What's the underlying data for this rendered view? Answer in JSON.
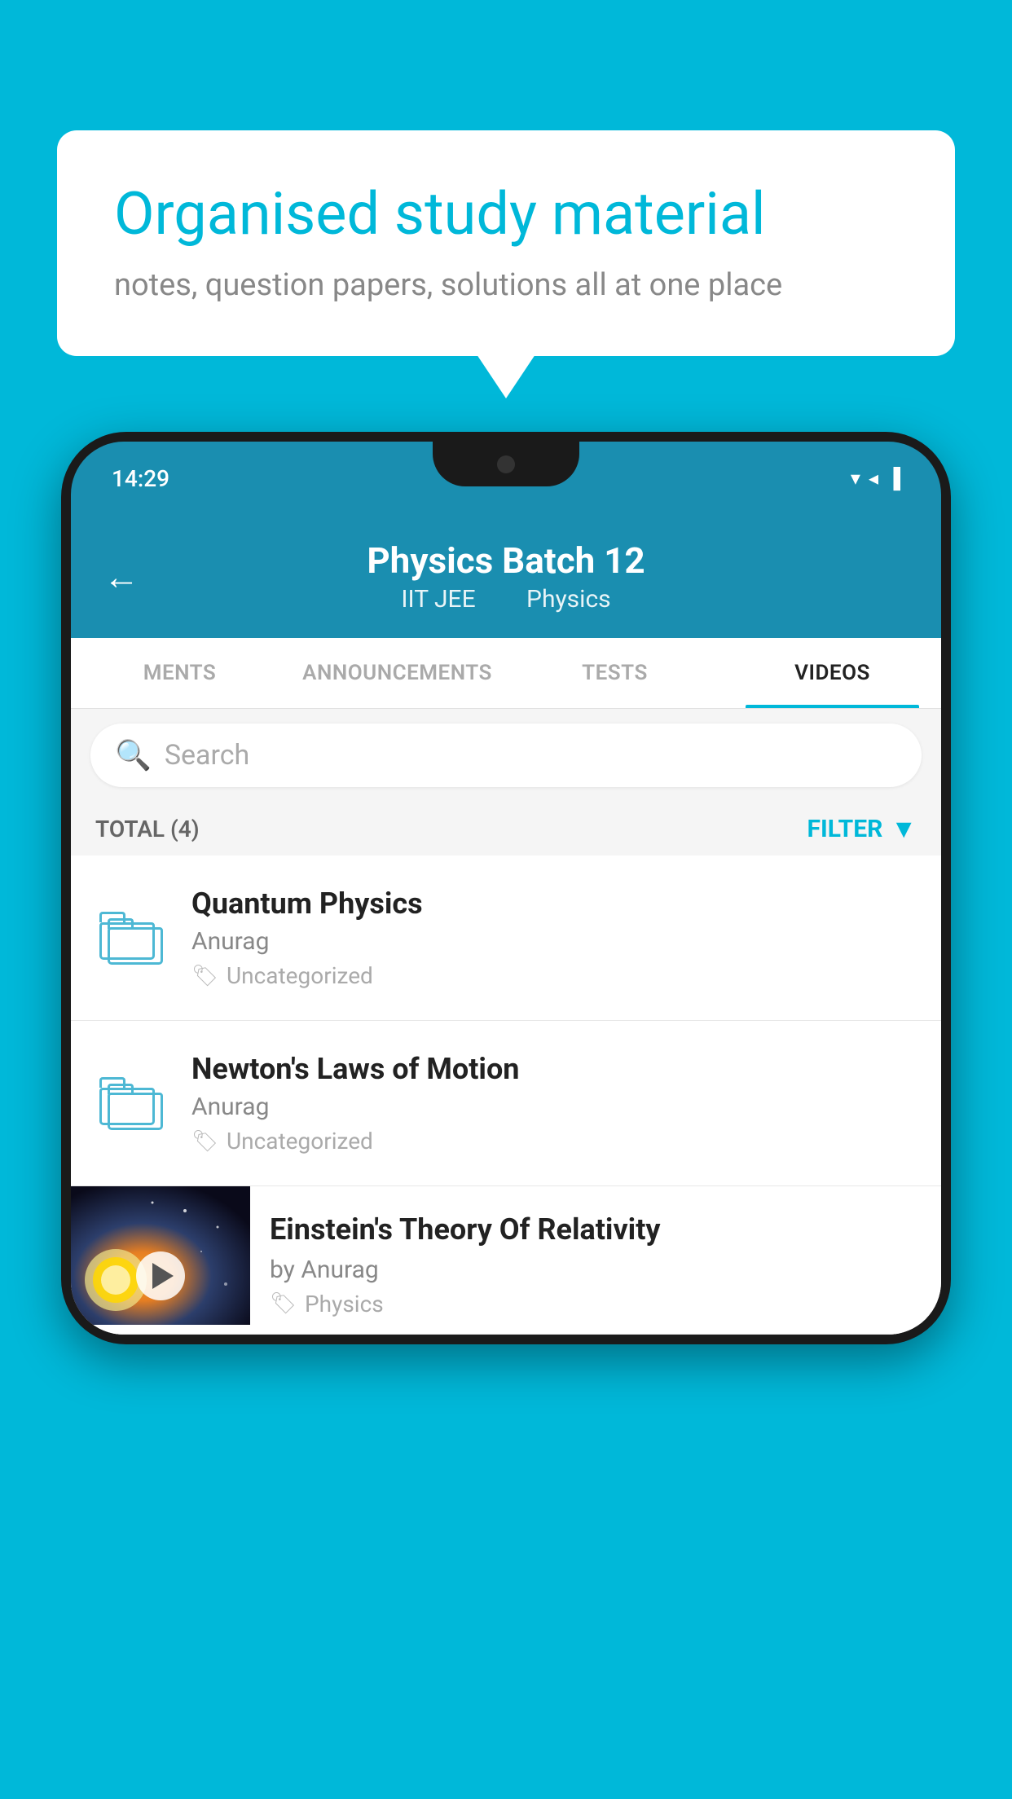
{
  "background_color": "#00b8d9",
  "speech_bubble": {
    "title": "Organised study material",
    "subtitle": "notes, question papers, solutions all at one place"
  },
  "status_bar": {
    "time": "14:29",
    "wifi": "▼",
    "signal": "▲",
    "battery": "▐"
  },
  "app_header": {
    "back_label": "←",
    "title": "Physics Batch 12",
    "subtitle_part1": "IIT JEE",
    "subtitle_part2": "Physics"
  },
  "tabs": [
    {
      "label": "MENTS",
      "active": false
    },
    {
      "label": "ANNOUNCEMENTS",
      "active": false
    },
    {
      "label": "TESTS",
      "active": false
    },
    {
      "label": "VIDEOS",
      "active": true
    }
  ],
  "search": {
    "placeholder": "Search"
  },
  "filter_row": {
    "total_label": "TOTAL (4)",
    "filter_label": "FILTER"
  },
  "video_items": [
    {
      "title": "Quantum Physics",
      "author": "Anurag",
      "tag": "Uncategorized",
      "has_thumb": false
    },
    {
      "title": "Newton's Laws of Motion",
      "author": "Anurag",
      "tag": "Uncategorized",
      "has_thumb": false
    },
    {
      "title": "Einstein's Theory Of Relativity",
      "author": "by Anurag",
      "tag": "Physics",
      "has_thumb": true
    }
  ]
}
